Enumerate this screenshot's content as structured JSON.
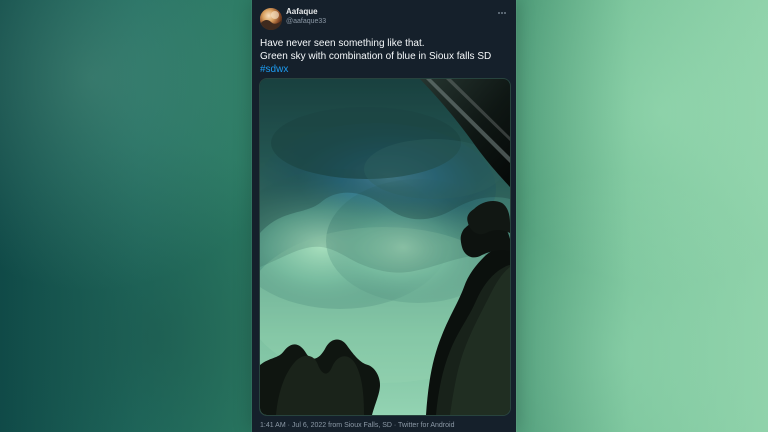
{
  "tweet": {
    "display_name": "Aafaque",
    "handle": "@aafaque33",
    "text": {
      "line1": "Have never seen something like that.",
      "line2": "Green sky with combination of blue in Sioux falls SD",
      "hashtag": "#sdwx"
    },
    "metadata": {
      "time": "1:41 AM",
      "date": "Jul 6, 2022",
      "location_prefix": "from",
      "location": "Sioux Falls, SD",
      "source": "Twitter for Android"
    }
  },
  "icons": {
    "more": "more-horizontal-icon"
  },
  "colors": {
    "card_background": "#15202b",
    "hashtag": "#1d9bf0",
    "primary_text": "#f5f8fa",
    "secondary_text": "#8b98a5"
  }
}
